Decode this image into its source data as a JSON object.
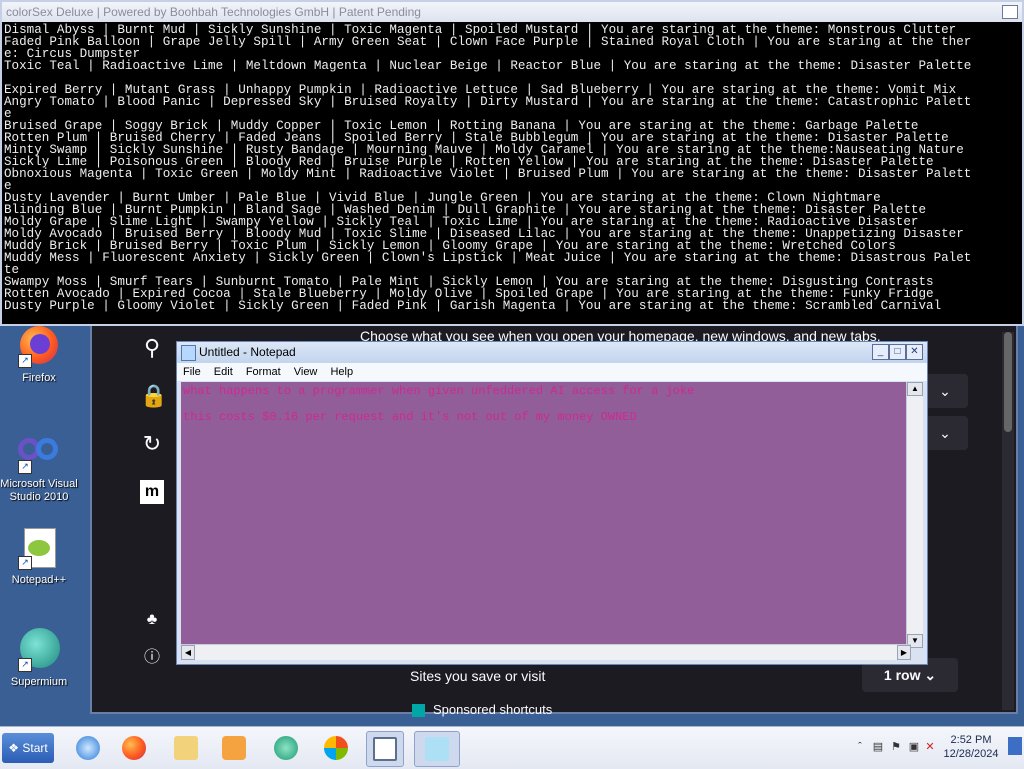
{
  "console": {
    "title": "colorSex Deluxe | Powered by Boohbah Technologies GmbH | Patent Pending",
    "lines": [
      "Dismal Abyss | Burnt Mud | Sickly Sunshine | Toxic Magenta | Spoiled Mustard | You are staring at the theme: Monstrous Clutter",
      "Faded Pink Balloon | Grape Jelly Spill | Army Green Seat | Clown Face Purple | Stained Royal Cloth | You are staring at the ther",
      "e: Circus Dumpster",
      "Toxic Teal | Radioactive Lime | Meltdown Magenta | Nuclear Beige | Reactor Blue | You are staring at the theme: Disaster Palette",
      "",
      "Expired Berry | Mutant Grass | Unhappy Pumpkin | Radioactive Lettuce | Sad Blueberry | You are staring at the theme: Vomit Mix",
      "Angry Tomato | Blood Panic | Depressed Sky | Bruised Royalty | Dirty Mustard | You are staring at the theme: Catastrophic Palett",
      "e",
      "Bruised Grape | Soggy Brick | Muddy Copper | Toxic Lemon | Rotting Banana | You are staring at the theme: Garbage Palette",
      "Rotten Plum | Bruised Cherry | Faded Jeans | Spoiled Berry | Stale Bubblegum | You are staring at the theme: Disaster Palette",
      "Minty Swamp | Sickly Sunshine | Rusty Bandage | Mourning Mauve | Moldy Caramel | You are staring at the theme:Nauseating Nature",
      "Sickly Lime | Poisonous Green | Bloody Red | Bruise Purple | Rotten Yellow | You are staring at the theme: Disaster Palette",
      "Obnoxious Magenta | Toxic Green | Moldy Mint | Radioactive Violet | Bruised Plum | You are staring at the theme: Disaster Palett",
      "e",
      "Dusty Lavender | Burnt Umber | Pale Blue | Vivid Blue | Jungle Green | You are staring at the theme: Clown Nightmare",
      "Blinding Blue | Burnt Pumpkin | Bland Sage | Washed Denim | Dull Graphite | You are staring at the theme: Disaster Palette",
      "Moldy Grape | Slime Light | Swampy Yellow | Sickly Teal | Toxic Lime | You are staring at the theme: Radioactive Disaster",
      "Moldy Avocado | Bruised Berry | Bloody Mud | Toxic Slime | Diseased Lilac | You are staring at the theme: Unappetizing Disaster",
      "Muddy Brick | Bruised Berry | Toxic Plum | Sickly Lemon | Gloomy Grape | You are staring at the theme: Wretched Colors",
      "Muddy Mess | Fluorescent Anxiety | Sickly Green | Clown's Lipstick | Meat Juice | You are staring at the theme: Disastrous Palet",
      "te",
      "Swampy Moss | Smurf Tears | Sunburnt Tomato | Pale Mint | Sickly Lemon | You are staring at the theme: Disgusting Contrasts",
      "Rotten Avocado | Expired Cocoa | Stale Blueberry | Moldy Olive | Spoiled Grape | You are staring at the theme: Funky Fridge",
      "Dusty Purple | Gloomy Violet | Sickly Green | Faded Pink | Garish Magenta | You are staring at the theme: Scrambled Carnival"
    ]
  },
  "browser": {
    "header_text": "Choose what you see when you open your homepage, new windows, and new tabs.",
    "sites_label": "Sites you save or visit",
    "rows_value": "1 row",
    "sponsored_label": "Sponsored shortcuts",
    "icons": [
      "search-icon",
      "lock-icon",
      "sync-icon",
      "mozilla-icon",
      "extensions-icon",
      "help-icon"
    ]
  },
  "notepad": {
    "title": "Untitled - Notepad",
    "menu": [
      "File",
      "Edit",
      "Format",
      "View",
      "Help"
    ],
    "lines": [
      "what happens to a programmer when given unfeddered AI access for a joke",
      "this costs $0.16 per request and it's not out of my money OWNED"
    ],
    "bg_color": "#915e99",
    "text_color": "#cc2a92"
  },
  "desktop": {
    "icons": [
      {
        "label": "Firefox",
        "icon": "firefox-icon"
      },
      {
        "label": "Microsoft Visual Studio 2010",
        "icon": "visual-studio-icon"
      },
      {
        "label": "Notepad++",
        "icon": "notepadpp-icon"
      },
      {
        "label": "Supermium",
        "icon": "supermium-icon"
      }
    ]
  },
  "taskbar": {
    "start_label": "Start",
    "pinned": [
      "ie-icon",
      "firefox-icon",
      "explorer-icon",
      "media-player-icon",
      "chat-icon",
      "windows-update-icon",
      "console-icon",
      "notepad-icon"
    ],
    "clock_time": "2:52 PM",
    "clock_date": "12/28/2024"
  }
}
